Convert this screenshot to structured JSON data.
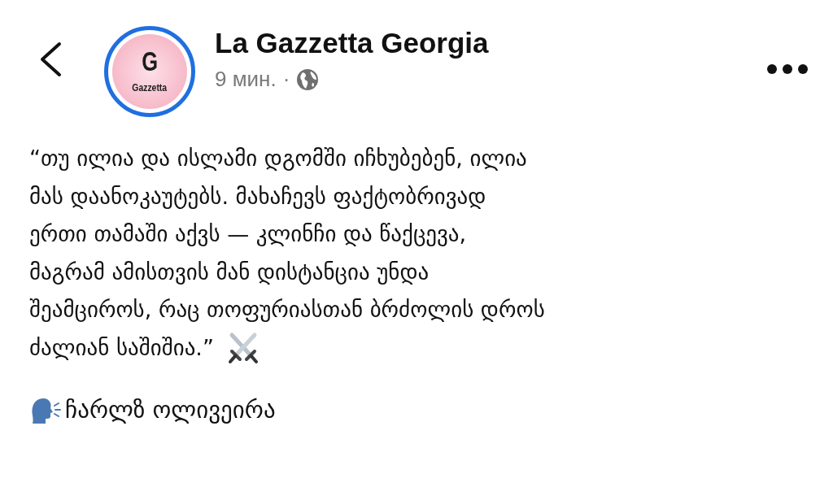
{
  "header": {
    "avatar": {
      "letter": "G",
      "wordmark": "Gazzetta"
    },
    "page_name": "La Gazzetta Georgia",
    "time": "9 мин.",
    "separator": "·"
  },
  "post": {
    "lines": [
      "“თუ ილია და ისლამი დგომში იჩხუბებენ, ილია",
      "მას დაანოკაუტებს. მახაჩევს ფაქტობრივად",
      "ერთი თამაში აქვს — კლინჩი და წაქცევა,",
      "მაგრამ ამისთვის მან დისტანცია უნდა",
      "შეამციროს, რაც თოფურიასთან ბრძოლის დროს",
      "ძალიან საშიშია.”"
    ],
    "speaker": "ჩარლზ ოლივეირა"
  }
}
